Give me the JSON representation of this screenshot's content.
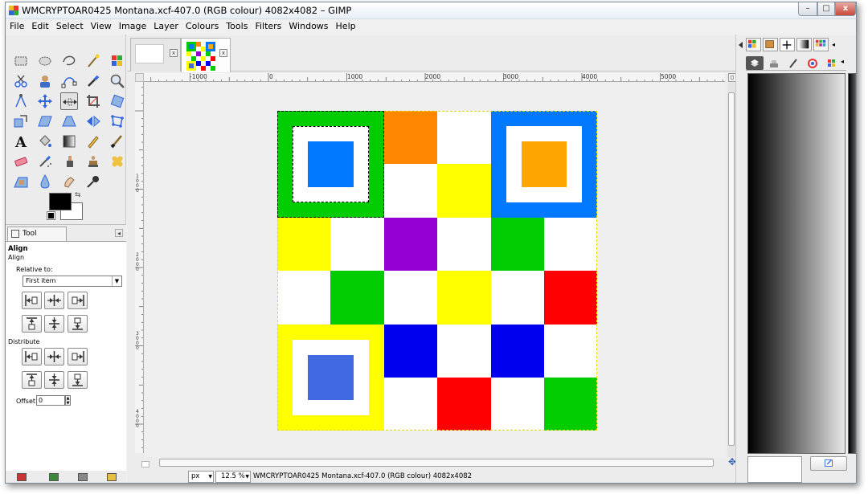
{
  "window": {
    "title": "WMCRYPTOAR0425 Montana.xcf-407.0 (RGB colour) 4082x4082 – GIMP",
    "min_label": "–",
    "max_label": "□",
    "close_label": "x"
  },
  "menu": [
    "File",
    "Edit",
    "Select",
    "View",
    "Image",
    "Layer",
    "Colours",
    "Tools",
    "Filters",
    "Windows",
    "Help"
  ],
  "toolbox": {
    "active_tool": "move-tool",
    "tool_options_tab": "Tool Options",
    "panel_menu_glyph": "◂",
    "options": {
      "title": "Align",
      "subtitle": "Align",
      "relative_to_label": "Relative to:",
      "relative_to_value": "First item",
      "distribute_label": "Distribute",
      "offset_label": "Offset:",
      "offset_value": "0"
    }
  },
  "image_window": {
    "tab_close_glyph": "x",
    "h_ruler_labels": [
      "-1000",
      "0",
      "1000",
      "2000",
      "3000",
      "4000",
      "5000"
    ],
    "v_ruler_labels": [
      "1000",
      "2000",
      "3000",
      "4000"
    ],
    "status": {
      "unit": "px",
      "zoom": "12.5 %",
      "text": "WMCRYPTOAR0425 Montana.xcf-407.0 (RGB colour) 4082x4082"
    }
  },
  "image_content": {
    "colors": {
      "green": "#00cc00",
      "blue": "#0078ff",
      "orange": "#ff8800",
      "orange_core": "#ffa500",
      "yellow": "#ffff00",
      "purple": "#9400d3",
      "red": "#ff0000",
      "dark_blue": "#0000ee",
      "royal_blue": "#4169e1",
      "white": "#ffffff"
    }
  },
  "dock": {
    "gradient_from": "#000000",
    "gradient_to": "#e8e8e8"
  }
}
